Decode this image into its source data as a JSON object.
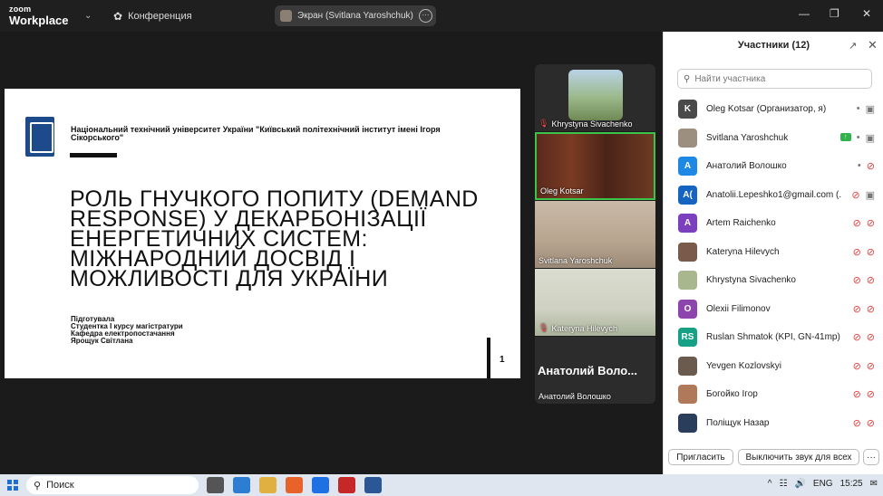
{
  "titlebar": {
    "logo_line1": "zoom",
    "logo_line2": "Workplace",
    "conference_label": "Конференция",
    "screen_pill": "Экран (Svitlana Yaroshchuk)"
  },
  "slide": {
    "university": "Національний технічний університет України \"Київський політехнічний інститут імені Ігоря Сікорського\"",
    "title": "РОЛЬ ГНУЧКОГО ПОПИТУ (DEMAND RESPONSE) У ДЕКАРБОНІЗАЦІЇ ЕНЕРГЕТИЧНИХ СИСТЕМ: МІЖНАРОДНИЙ ДОСВІД І МОЖЛИВОСТІ ДЛЯ УКРАЇНИ",
    "credits": [
      "Підготувала",
      "Студентка І курсу магістратури",
      "Кафедра електропостачання",
      "Ярощук Світлана"
    ],
    "page_number": "1"
  },
  "tiles": [
    {
      "name": "Khrystyna Sivachenko",
      "muted": true
    },
    {
      "name": "Oleg Kotsar",
      "muted": false
    },
    {
      "name": "Svitlana Yaroshchuk",
      "muted": false
    },
    {
      "name": "Kateryna Hilevych",
      "muted": true
    },
    {
      "name": "Анатолий Волошко",
      "big": "Анатолий Воло..."
    }
  ],
  "panel": {
    "title": "Участники (12)",
    "search_placeholder": "Найти участника",
    "participants": [
      {
        "initials": "K",
        "color": "#4a4a4a",
        "name": "Oleg Kotsar (Организатор, я)",
        "mic": "on",
        "cam": "on"
      },
      {
        "initials": "",
        "color": "#9c8f80",
        "name": "Svitlana Yaroshchuk",
        "mic": "on",
        "cam": "on",
        "sharing": true
      },
      {
        "initials": "A",
        "color": "#1e88e5",
        "name": "Анатолий Волошко",
        "mic": "on",
        "cam": "off"
      },
      {
        "initials": "A(",
        "color": "#1565c0",
        "name": "Anatolii.Lepeshko1@gmail.com (...",
        "mic": "off",
        "cam": "on"
      },
      {
        "initials": "A",
        "color": "#7b3fbf",
        "name": "Artem Raichenko",
        "mic": "off",
        "cam": "off"
      },
      {
        "initials": "",
        "color": "#7a5a4a",
        "name": "Kateryna Hilevych",
        "mic": "off",
        "cam": "off"
      },
      {
        "initials": "",
        "color": "#a9b78f",
        "name": "Khrystyna Sivachenko",
        "mic": "off",
        "cam": "off"
      },
      {
        "initials": "O",
        "color": "#8e44ad",
        "name": "Olexii Filimonov",
        "mic": "off",
        "cam": "off"
      },
      {
        "initials": "RS",
        "color": "#16a085",
        "name": "Ruslan Shmatok (KPI, GN-41mp)",
        "mic": "off",
        "cam": "off"
      },
      {
        "initials": "",
        "color": "#6b5a4e",
        "name": "Yevgen Kozlovskyi",
        "mic": "off",
        "cam": "off"
      },
      {
        "initials": "",
        "color": "#b07a5a",
        "name": "Богойко Ігор",
        "mic": "off",
        "cam": "off"
      },
      {
        "initials": "",
        "color": "#2a3d5a",
        "name": "Поліщук Назар",
        "mic": "off",
        "cam": "off"
      }
    ],
    "invite_label": "Пригласить",
    "mute_all_label": "Выключить звук для всех",
    "more_label": "···"
  },
  "taskbar": {
    "search_label": "Поиск",
    "lang": "ENG",
    "time": "15:25"
  }
}
